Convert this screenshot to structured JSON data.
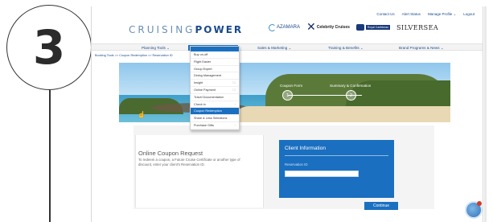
{
  "step_number": "3",
  "header": {
    "top_links": [
      "Contact Us",
      "Alert Status",
      "Manage Profile ⌄",
      "Logout"
    ],
    "logo_left": "CRUISING",
    "logo_right": "POWER",
    "brands": {
      "azamara": "AZAMARA",
      "celebrity": "Celebrity Cruises",
      "royal_caribbean": "Royal Caribbean",
      "silversea": "SILVERSEA"
    }
  },
  "nav": {
    "items": [
      {
        "label": "Planning Tools ⌄",
        "active": false
      },
      {
        "label": "Booking Tools ⌄",
        "active": true
      },
      {
        "label": "Sales & Marketing ⌄",
        "active": false
      },
      {
        "label": "Training & Benefits ⌄",
        "active": false
      },
      {
        "label": "Brand Programs & News ⌄",
        "active": false
      }
    ]
  },
  "breadcrumb": "Booking Tools  >>  Coupon Redemption  >>  Reservation ID",
  "dropdown": {
    "items": [
      {
        "label": "Buy on-off",
        "selected": false,
        "indicator": ""
      },
      {
        "label": "Flight Easier",
        "selected": false,
        "indicator": ""
      },
      {
        "label": "Group Expert",
        "selected": false,
        "indicator": ""
      },
      {
        "label": "Dining Management",
        "selected": false,
        "indicator": ""
      },
      {
        "label": "Insight",
        "selected": false,
        "indicator": "☐"
      },
      {
        "label": "Online Payment",
        "selected": false,
        "indicator": "☐"
      },
      {
        "label": "Travel Documentation",
        "selected": false,
        "indicator": ""
      },
      {
        "label": "Check in",
        "selected": false,
        "indicator": "›"
      },
      {
        "label": "Coupon Redemption",
        "selected": true,
        "indicator": ""
      },
      {
        "label": "Share & Less Selections",
        "selected": false,
        "indicator": ""
      },
      {
        "label": "Purchase Gifts",
        "selected": false,
        "indicator": "›"
      }
    ]
  },
  "hero": {
    "step1_label": "Coupon Form",
    "step1_num": "1",
    "step2_label": "Summary & Confirmation",
    "step2_num": "2"
  },
  "coupon": {
    "title": "Online Coupon Request",
    "description": "To redeem a coupon, a Future Cruise Certificate or another type of discount, enter your client's Reservation ID."
  },
  "client_info": {
    "title": "Client Information",
    "label": "Reservation ID",
    "input_value": "",
    "continue_label": "Continue"
  },
  "colors": {
    "primary": "#1a6fc0",
    "navy": "#1a4a8a"
  }
}
